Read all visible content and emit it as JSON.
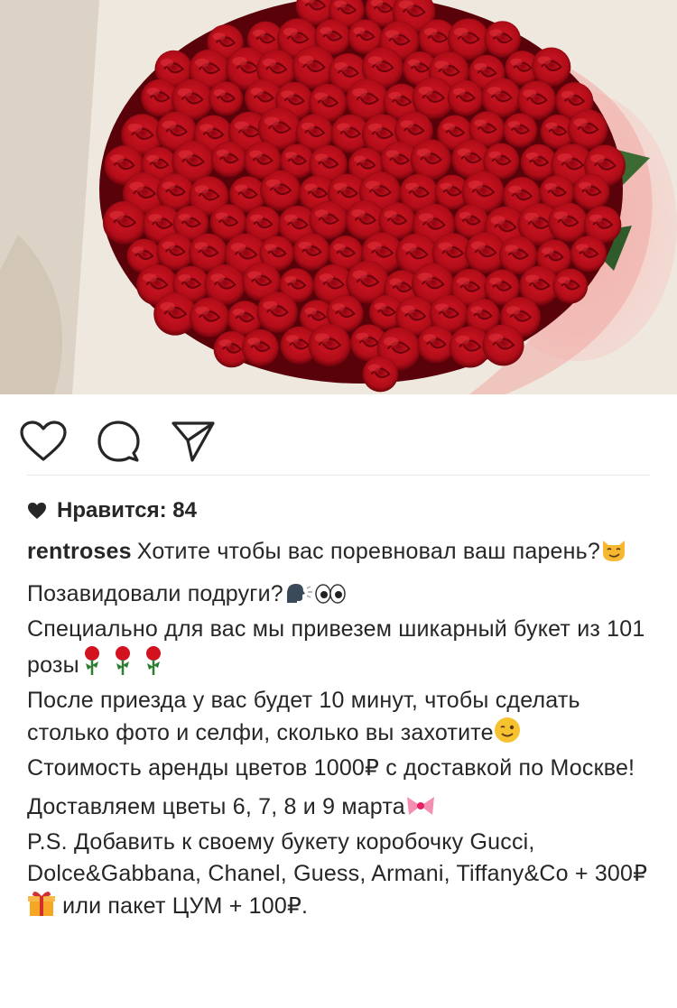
{
  "post": {
    "image_description_icon": "roses-bouquet-photo",
    "actions": {
      "like_icon": "heart-outline-icon",
      "comment_icon": "comment-bubble-icon",
      "share_icon": "paper-plane-icon"
    },
    "likes_label": "Нравится: 84",
    "username": "rentroses",
    "caption_lines": [
      "Хотите чтобы вас поревновал ваш парень?",
      "Позавидовали подруги?",
      "Специально для вас мы привезем шикарный букет из 101 розы",
      "После приезда у вас будет 10 минут, чтобы сделать столько фото и селфи, сколько вы захотите",
      "Стоимость аренды цветов 1000₽ с доставкой по Москве!",
      "Доставляем цветы 6, 7, 8 и 9 марта",
      "P.S. Добавить к своему букету коробочку Gucci, Dolce&Gabbana, Chanel, Guess, Armani, Tiffany&Co + 300₽",
      "или пакет ЦУМ + 100₽."
    ]
  }
}
